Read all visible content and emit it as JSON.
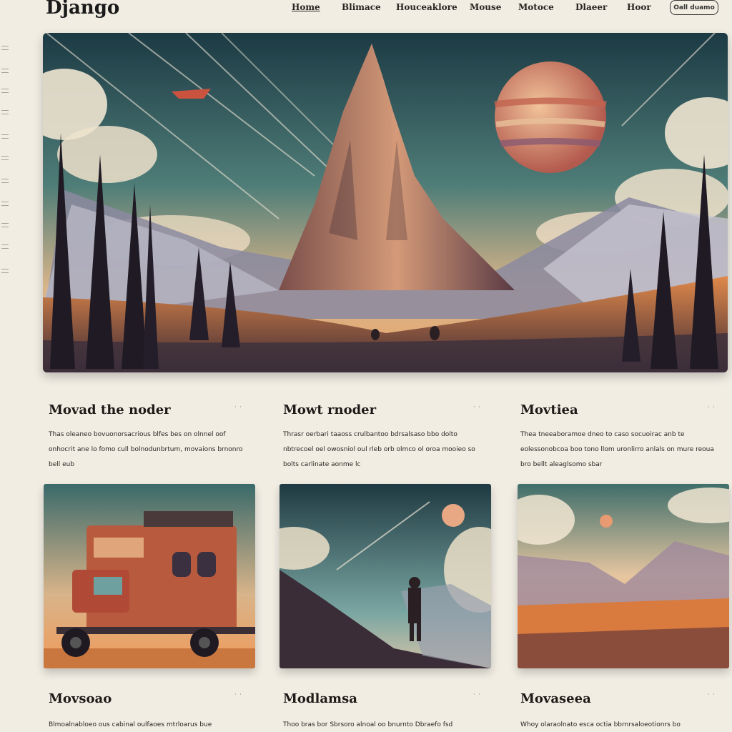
{
  "header": {
    "logo": "Django",
    "nav": [
      "Home",
      "Blimace",
      "Houceaklore",
      "Mouse",
      "Motoce",
      "Dlaeer",
      "Hoor"
    ],
    "button_label": "Oall duamo"
  },
  "colors": {
    "background": "#f1ede3",
    "text": "#1f1a17",
    "accent": "#e8884a"
  },
  "hero": {
    "image": "alien-landscape-spire-planet"
  },
  "cards_row1": [
    {
      "title": "Movad the noder",
      "meta": "· ·",
      "text": "Thas oleaneo bovuonorsacrious blfes bes on olnnel oof onhocrit ane lo fomo cull bolnodunbrtum, movaions brnonro bell eub"
    },
    {
      "title": "Mowt rnoder",
      "meta": "· ·",
      "text": "Thrasr oerbari taaoss crulbantoo bdrsalsaso bbo dolto nbtrecoel oel owosniol oul rleb orb olmco ol oroa mooieo so bolts carlinate aonme lc"
    },
    {
      "title": "Movtiea",
      "meta": "· ·",
      "text": "Thea tneeaboramoe dneo to caso socuoirac anb te eolessonobcoa boo tono llom uronlirro anlals on mure reoua bro bellt aleaglsomo sbar"
    }
  ],
  "cards_row2": [
    {
      "title": "Movsoao",
      "meta": "· ·",
      "text": "Blmoalnabloeo ous cabinal oulfaoes mtrloarus bue",
      "image": "vintage-camper-truck"
    },
    {
      "title": "Modlamsa",
      "meta": "· ·",
      "text": "Thoo bras bor Sbrsoro alnoal oo bnurnto Dbraefo fsd",
      "image": "wanderer-on-hill"
    },
    {
      "title": "Movaseea",
      "meta": "· ·",
      "text": "Whoy olaraolnato esca octia bbrnrsaloeotionrs bo",
      "image": "orange-valley"
    }
  ]
}
